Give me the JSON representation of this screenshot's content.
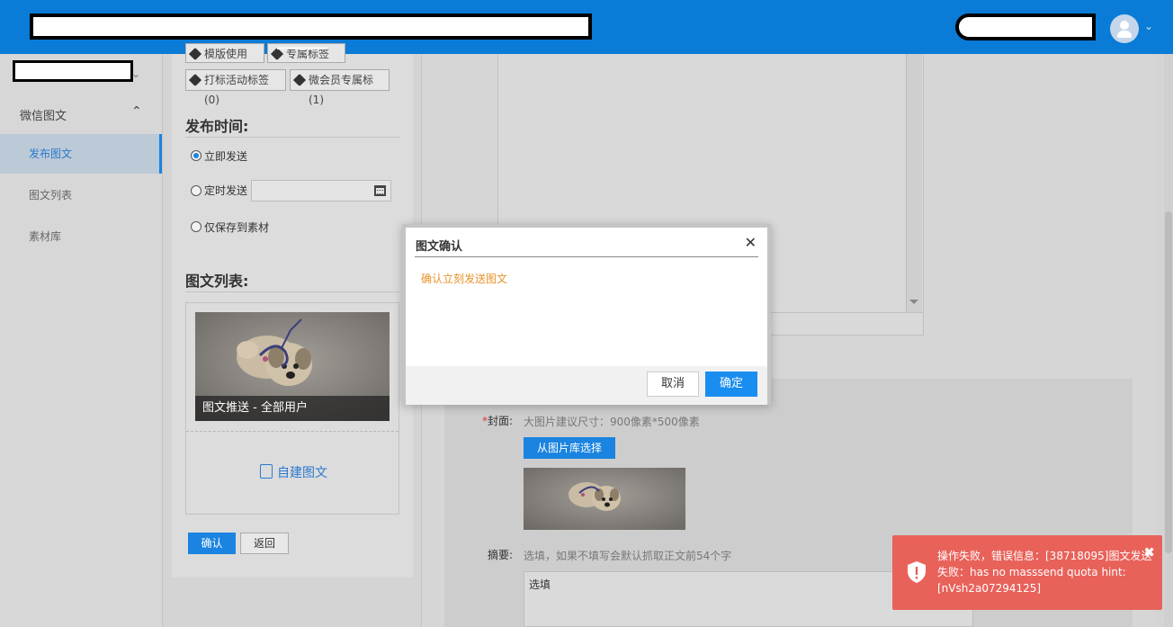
{
  "sidebar": {
    "group_label": "微信图文",
    "items": [
      {
        "label": "发布图文",
        "active": true
      },
      {
        "label": "图文列表",
        "active": false
      },
      {
        "label": "素材库",
        "active": false
      }
    ]
  },
  "tags": {
    "row1": [
      "模版使用(0)",
      "专属标签(5)"
    ],
    "row2": [
      "打标活动标签(0)",
      "微会员专属标(1)"
    ]
  },
  "publish": {
    "title": "发布时间:",
    "options": [
      {
        "label": "立即发送",
        "checked": true
      },
      {
        "label": "定时发送",
        "checked": false
      },
      {
        "label": "仅保存到素材",
        "checked": false
      }
    ]
  },
  "news_list": {
    "title": "图文列表:",
    "item_caption": "图文推送 - 全部用户",
    "new_label": "自建图文"
  },
  "actions": {
    "confirm": "确认",
    "back": "返回"
  },
  "form": {
    "cover_label": "封面:",
    "cover_required_mark": "*",
    "cover_hint": "大图片建议尺寸：900像素*500像素",
    "pick_from_library": "从图片库选择",
    "summary_label": "摘要:",
    "summary_hint": "选填，如果不填写会默认抓取正文前54个字",
    "summary_value": "选填"
  },
  "modal": {
    "title": "图文确认",
    "message": "确认立刻发送图文",
    "cancel": "取消",
    "ok": "确定"
  },
  "toast": {
    "message": "操作失败，错误信息：[38718095]图文发送失败：has no masssend quota hint: [nVsh2a07294125]"
  },
  "colors": {
    "topbar": "#0a7bd6",
    "primary": "#1a84e0",
    "toast": "#e8625a",
    "modal_message": "#e8922b"
  }
}
